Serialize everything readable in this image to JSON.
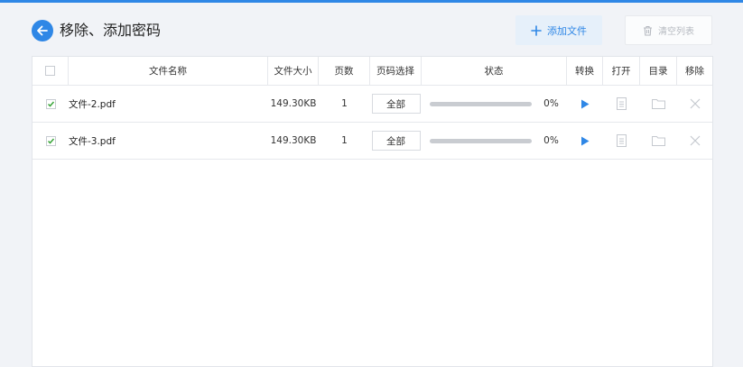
{
  "header": {
    "title": "移除、添加密码",
    "add_button": "添加文件",
    "clear_button": "清空列表"
  },
  "table": {
    "columns": [
      "文件名称",
      "文件大小",
      "页数",
      "页码选择",
      "状态",
      "转换",
      "打开",
      "目录",
      "移除"
    ],
    "rows": [
      {
        "checked": true,
        "name": "文件-2.pdf",
        "size": "149.30KB",
        "pages": "1",
        "page_select": "全部",
        "progress": 0,
        "status": "0%"
      },
      {
        "checked": true,
        "name": "文件-3.pdf",
        "size": "149.30KB",
        "pages": "1",
        "page_select": "全部",
        "progress": 0,
        "status": "0%"
      }
    ]
  },
  "colors": {
    "accent": "#2f87e6",
    "icon_disabled": "#c5c9cf"
  }
}
